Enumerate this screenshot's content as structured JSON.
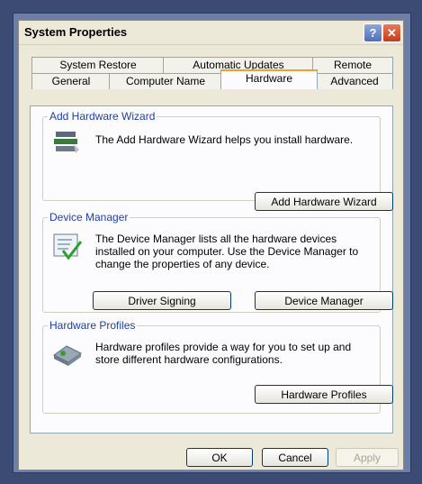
{
  "window": {
    "title": "System Properties",
    "help": "?",
    "close": "✕"
  },
  "tabs_row1": [
    "System Restore",
    "Automatic Updates",
    "Remote"
  ],
  "tabs_row2": [
    "General",
    "Computer Name",
    "Hardware",
    "Advanced"
  ],
  "active_tab": "Hardware",
  "wizard": {
    "legend": "Add Hardware Wizard",
    "text": "The Add Hardware Wizard helps you install hardware.",
    "button": "Add Hardware Wizard"
  },
  "device_manager": {
    "legend": "Device Manager",
    "text": "The Device Manager lists all the hardware devices installed on your computer. Use the Device Manager to change the properties of any device.",
    "button_signing": "Driver Signing",
    "button_manager": "Device Manager"
  },
  "profiles": {
    "legend": "Hardware Profiles",
    "text": "Hardware profiles provide a way for you to set up and store different hardware configurations.",
    "button": "Hardware Profiles"
  },
  "footer": {
    "ok": "OK",
    "cancel": "Cancel",
    "apply": "Apply"
  },
  "colors": {
    "legend": "#1c3fa8",
    "tab_highlight": "#f0a030",
    "button_border": "#003c74"
  }
}
